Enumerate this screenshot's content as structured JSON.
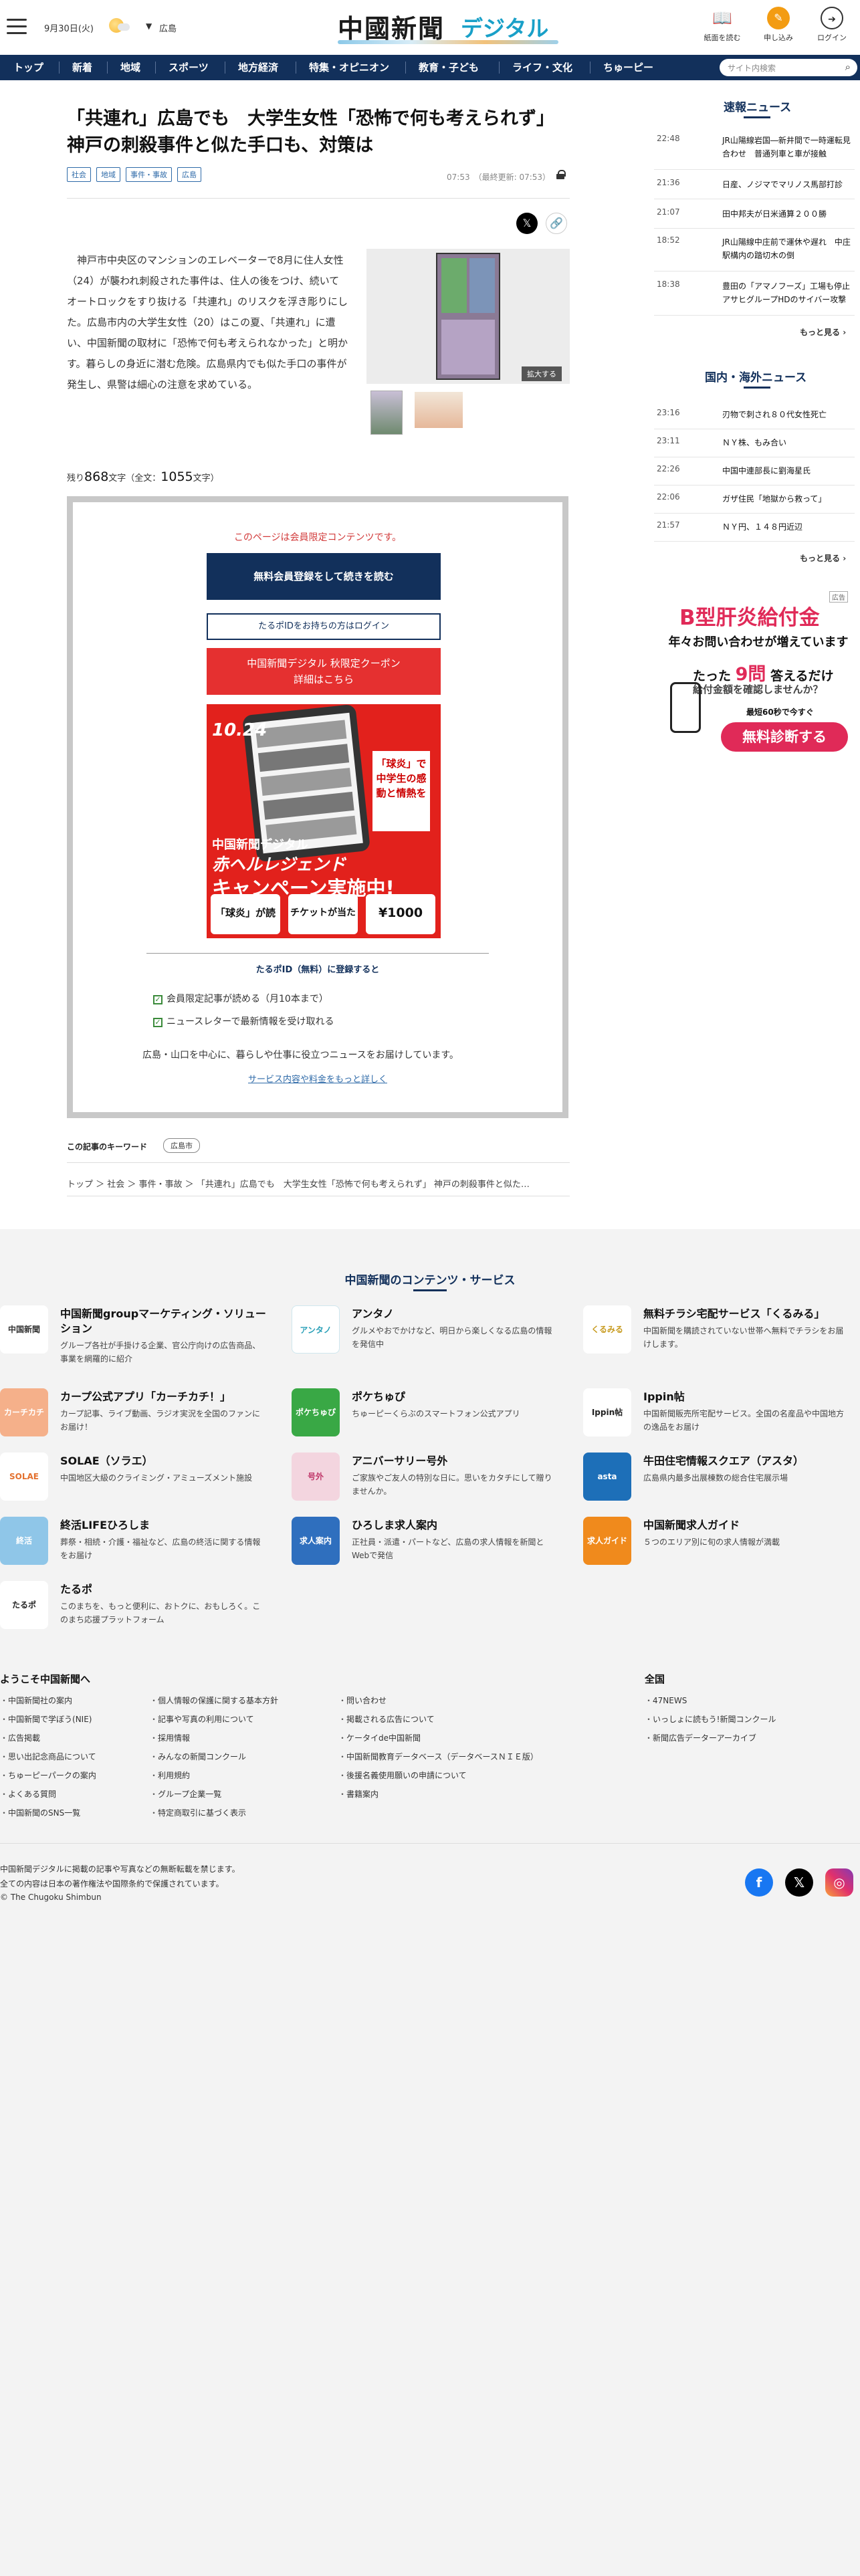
{
  "header": {
    "date": "9月30日(火)",
    "region": "広島",
    "logo_main": "中國新聞",
    "logo_sub": "デジタル",
    "buttons": [
      "紙面を読む",
      "申し込み",
      "ログイン"
    ]
  },
  "nav": {
    "items": [
      "トップ",
      "新着",
      "地域",
      "スポーツ",
      "地方経済",
      "特集・オピニオン",
      "教育・子ども",
      "ライフ・文化",
      "ちゅーピー"
    ],
    "search_placeholder": "サイト内検索"
  },
  "article": {
    "headline": "「共連れ」広島でも　大学生女性「恐怖で何も考えられず」神戸の刺殺事件と似た手口も、対策は",
    "tags": [
      "社会",
      "地域",
      "事件・事故",
      "広島"
    ],
    "time": "07:53　（最終更新: 07:53）",
    "lead": "　神戸市中央区のマンションのエレベーターで8月に住人女性（24）が襲われ刺殺された事件は、住人の後をつけ、続いてオートロックをすり抜ける「共連れ」のリスクを浮き彫りにした。広島市内の大学生女性（20）はこの夏、「共連れ」に遭い、中国新聞の取材に「恐怖で何も考えられなかった」と明かす。暮らしの身近に潜む危険。広島県内でも似た手口の事件が発生し、県警は細心の注意を求めている。",
    "enlarge": "拡大する",
    "remain_prefix": "残り",
    "remain_count": "868",
    "remain_mid": "文字（全文：",
    "remain_total": "1055",
    "remain_suffix": "文字）"
  },
  "paywall": {
    "note": "このページは会員限定コンテンツです。",
    "register_button": "無料会員登録をして続きを読む",
    "login_button": "たるポIDをお持ちの方はログイン",
    "coupon_line1": "中国新聞デジタル 秋限定クーポン",
    "coupon_line2": "詳細はこちら",
    "banner": {
      "date": "10.24",
      "badge": "「球炎」で中学生の感動と情熱を",
      "brand": "中国新聞デジタル",
      "title": "赤ヘルレジェンド",
      "title2": "キャンペーン実施中!",
      "box1": "「球炎」が読める!",
      "box2": "チケットが当たる!",
      "box3": "¥1000 OFF!"
    },
    "id_title": "たるポID（無料）に登録すると",
    "checks": [
      "会員限定記事が読める（月10本まで）",
      "ニュースレターで最新情報を受け取れる"
    ],
    "desc": "広島・山口を中心に、暮らしや仕事に役立つニュースをお届けしています。",
    "more_link": "サービス内容や料金をもっと詳しく"
  },
  "keywords": {
    "label": "この記事のキーワード",
    "tag": "広島市"
  },
  "breadcrumb": "トップ ＞ 社会 ＞ 事件・事故 ＞ 「共連れ」広島でも　大学生女性「恐怖で何も考えられず」 神戸の刺殺事件と似た…",
  "sidebar": {
    "breaking_title": "速報ニュース",
    "breaking": [
      {
        "time": "22:48",
        "text": "JR山陽線岩国―新井間で一時運転見合わせ　普通列車と車が接触"
      },
      {
        "time": "21:36",
        "text": "日産、ノジマでマリノス馬部打診"
      },
      {
        "time": "21:07",
        "text": "田中邦夫が日米通算２００勝"
      },
      {
        "time": "18:52",
        "text": "JR山陽線中庄前で運休や遅れ　中庄駅構内の踏切木の倒"
      },
      {
        "time": "18:38",
        "text": "豊田の「アマノフーズ」工場も停止　アサヒグループHDのサイバー攻撃"
      }
    ],
    "more": "もっと見る",
    "national_title": "国内・海外ニュース",
    "national": [
      {
        "time": "23:16",
        "text": "刃物で刺され８０代女性死亡"
      },
      {
        "time": "23:11",
        "text": "ＮＹ株、もみ合い"
      },
      {
        "time": "22:26",
        "text": "中国中連部長に劉海星氏"
      },
      {
        "time": "22:06",
        "text": "ガザ住民「地獄から救って」"
      },
      {
        "time": "21:57",
        "text": "ＮＹ円、１４８円近辺"
      }
    ],
    "ad": {
      "mark": "広告",
      "h1": "B型肝炎給付金",
      "h2": "年々お問い合わせが増えています",
      "h3_pre": "たった",
      "h3_big": "9問",
      "h3_post": "答えるだけ",
      "h4": "給付金額を確認しませんか？",
      "h5": "最短60秒で今すぐ",
      "button": "無料診断する"
    }
  },
  "services": {
    "title": "中国新聞のコンテンツ・サービス",
    "items": [
      {
        "name": "中国新聞groupマーケティング・ソリューション",
        "desc": "グループ各社が手掛ける企業、官公庁向けの広告商品、事業を網羅的に紹介",
        "icon": "中国新聞"
      },
      {
        "name": "アンタノ",
        "desc": "グルメやおでかけなど、明日から楽しくなる広島の情報を発信中",
        "icon": "アンタノ"
      },
      {
        "name": "無料チラシ宅配サービス「くるみる」",
        "desc": "中国新聞を購読されていない世帯へ無料でチラシをお届けします。",
        "icon": "くるみる"
      },
      {
        "name": "カープ公式アプリ「カーチカチ！」",
        "desc": "カープ記事、ライブ動画、ラジオ実況を全国のファンにお届け！",
        "icon": "カーチカチ"
      },
      {
        "name": "ポケちゅぴ",
        "desc": "ちゅーピーくらぶのスマートフォン公式アプリ",
        "icon": "ポケちゅぴ"
      },
      {
        "name": "Ippin帖",
        "desc": "中国新聞販売所宅配サービス。全国の名産品や中国地方の逸品をお届け",
        "icon": "Ippin帖"
      },
      {
        "name": "SOLAE（ソラエ）",
        "desc": "中国地区大級のクライミング・アミューズメント施設",
        "icon": "SOLAE"
      },
      {
        "name": "アニバーサリー号外",
        "desc": "ご家族やご友人の特別な日に。思いをカタチにして贈りませんか。",
        "icon": "号外"
      },
      {
        "name": "牛田住宅情報スクエア（アスタ）",
        "desc": "広島県内最多出展棟数の総合住宅展示場",
        "icon": "asta"
      },
      {
        "name": "終活LIFEひろしま",
        "desc": "葬祭・相続・介護・福祉など、広島の終活に関する情報をお届け",
        "icon": "終活"
      },
      {
        "name": "ひろしま求人案内",
        "desc": "正社員・派遣・パートなど、広島の求人情報を新聞とWebで発信",
        "icon": "求人案内"
      },
      {
        "name": "中国新聞求人ガイド",
        "desc": "５つのエリア別に旬の求人情報が満載",
        "icon": "求人ガイド"
      },
      {
        "name": "たるポ",
        "desc": "このまちを、もっと便利に、おトクに、おもしろく。このまち応援プラットフォーム",
        "icon": "たるポ"
      }
    ]
  },
  "footer": {
    "welcome": "ようこそ中国新聞へ",
    "national": "全国",
    "col1": [
      "中国新聞社の案内",
      "中国新聞で学ぼう(NIE)",
      "広告掲載",
      "思い出記念商品について",
      "ちゅーピーパークの案内",
      "よくある質問",
      "中国新聞のSNS一覧"
    ],
    "col2": [
      "個人情報の保護に関する基本方針",
      "記事や写真の利用について",
      "採用情報",
      "みんなの新聞コンクール",
      "利用規約",
      "グループ企業一覧",
      "特定商取引に基づく表示"
    ],
    "col3": [
      "問い合わせ",
      "掲載される広告について",
      "ケータイde中国新聞",
      "中国新聞教育データベース（データベースＮＩＥ版）",
      "後援名義使用願いの申請について",
      "書籍案内"
    ],
    "col4": [
      "47NEWS",
      "いっしょに読もう!新聞コンクール",
      "新聞広告データーアーカイブ"
    ],
    "copy1": "中国新聞デジタルに掲載の記事や写真などの無断転載を禁じます。",
    "copy2": "全ての内容は日本の著作権法や国際条約で保護されています。",
    "copy3": "© The Chugoku Shimbun"
  },
  "colors": {
    "nav": "#12305b",
    "accent_red": "#e53030",
    "link_blue": "#2e6aa8",
    "ad_pink": "#e02a58"
  }
}
